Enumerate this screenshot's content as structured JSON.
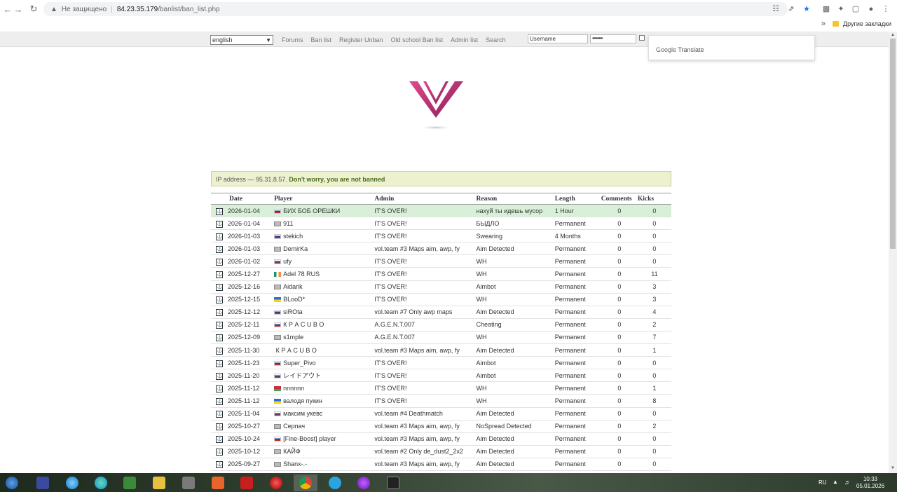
{
  "browser": {
    "security_label": "Не защищено",
    "url_host": "84.23.35.179",
    "url_path": "/banlist/ban_list.php",
    "other_bookmarks": "Другие закладки"
  },
  "site": {
    "language": "english",
    "nav": [
      "Forums",
      "Ban list",
      "Register Unban",
      "Old school Ban list",
      "Admin list",
      "Search"
    ],
    "username_value": "Username",
    "password_mask": "••••••••",
    "google_translate_brand": "Google",
    "google_translate_label": "Translate"
  },
  "notice": {
    "prefix": "IP address — 95.31.8.57.",
    "message": "Don't worry, you are not banned"
  },
  "table": {
    "headers": [
      "Date",
      "Player",
      "Admin",
      "Reason",
      "Length",
      "Comments",
      "Kicks"
    ],
    "rows": [
      {
        "date": "2026-01-04",
        "flag": "ru",
        "player": "БИХ БОБ ОРЕШКИ",
        "admin": "IT'S OVER!",
        "reason": "нахуй ты идешь мусор",
        "length": "1 Hour",
        "comments": "0",
        "kicks": "0"
      },
      {
        "date": "2026-01-04",
        "flag": "un",
        "player": "911",
        "admin": "IT'S OVER!",
        "reason": "БЫДЛО",
        "length": "Permanent",
        "comments": "0",
        "kicks": "0"
      },
      {
        "date": "2026-01-03",
        "flag": "ru",
        "player": "stekich",
        "admin": "IT'S OVER!",
        "reason": "Swearing",
        "length": "4 Months",
        "comments": "0",
        "kicks": "0"
      },
      {
        "date": "2026-01-03",
        "flag": "un",
        "player": "DemirKa",
        "admin": "vol.team #3 Maps aim, awp, fy",
        "reason": "Aim Detected",
        "length": "Permanent",
        "comments": "0",
        "kicks": "0"
      },
      {
        "date": "2026-01-02",
        "flag": "ru",
        "player": "ufy",
        "admin": "IT'S OVER!",
        "reason": "WH",
        "length": "Permanent",
        "comments": "0",
        "kicks": "0"
      },
      {
        "date": "2025-12-27",
        "flag": "ie",
        "player": "Adel 78 RUS",
        "admin": "IT'S OVER!",
        "reason": "WH",
        "length": "Permanent",
        "comments": "0",
        "kicks": "11"
      },
      {
        "date": "2025-12-16",
        "flag": "un",
        "player": "Aidarik",
        "admin": "IT'S OVER!",
        "reason": "Aimbot",
        "length": "Permanent",
        "comments": "0",
        "kicks": "3"
      },
      {
        "date": "2025-12-15",
        "flag": "ua",
        "player": "BLooD*",
        "admin": "IT'S OVER!",
        "reason": "WH",
        "length": "Permanent",
        "comments": "0",
        "kicks": "3"
      },
      {
        "date": "2025-12-12",
        "flag": "ru",
        "player": "siROta",
        "admin": "vol.team #7 Only awp maps",
        "reason": "Aim Detected",
        "length": "Permanent",
        "comments": "0",
        "kicks": "4"
      },
      {
        "date": "2025-12-11",
        "flag": "ru",
        "player": "К Р А С U В О",
        "admin": "A.G.E.N.T.007",
        "reason": "Cheating",
        "length": "Permanent",
        "comments": "0",
        "kicks": "2"
      },
      {
        "date": "2025-12-09",
        "flag": "un",
        "player": "s1mple",
        "admin": "A.G.E.N.T.007",
        "reason": "WH",
        "length": "Permanent",
        "comments": "0",
        "kicks": "7"
      },
      {
        "date": "2025-11-30",
        "flag": "",
        "player": "К Р А С U В О",
        "admin": "vol.team #3 Maps aim, awp, fy",
        "reason": "Aim Detected",
        "length": "Permanent",
        "comments": "0",
        "kicks": "1"
      },
      {
        "date": "2025-11-23",
        "flag": "ru",
        "player": "Super_Pivo",
        "admin": "IT'S OVER!",
        "reason": "Aimbot",
        "length": "Permanent",
        "comments": "0",
        "kicks": "0"
      },
      {
        "date": "2025-11-20",
        "flag": "ru",
        "player": "レイドアウト",
        "admin": "IT'S OVER!",
        "reason": "Aimbot",
        "length": "Permanent",
        "comments": "0",
        "kicks": "0"
      },
      {
        "date": "2025-11-12",
        "flag": "by",
        "player": "nnnnnn",
        "admin": "IT'S OVER!",
        "reason": "WH",
        "length": "Permanent",
        "comments": "0",
        "kicks": "1"
      },
      {
        "date": "2025-11-12",
        "flag": "ua",
        "player": "валодя пукин",
        "admin": "IT'S OVER!",
        "reason": "WH",
        "length": "Permanent",
        "comments": "0",
        "kicks": "8"
      },
      {
        "date": "2025-11-04",
        "flag": "ru",
        "player": "максим укевс",
        "admin": "vol.team #4 Deathmatch",
        "reason": "Aim Detected",
        "length": "Permanent",
        "comments": "0",
        "kicks": "0"
      },
      {
        "date": "2025-10-27",
        "flag": "un",
        "player": "Серпач",
        "admin": "vol.team #3 Maps aim, awp, fy",
        "reason": "NoSpread Detected",
        "length": "Permanent",
        "comments": "0",
        "kicks": "2"
      },
      {
        "date": "2025-10-24",
        "flag": "ru",
        "player": "[Fine-Boost] player",
        "admin": "vol.team #3 Maps aim, awp, fy",
        "reason": "Aim Detected",
        "length": "Permanent",
        "comments": "0",
        "kicks": "0"
      },
      {
        "date": "2025-10-12",
        "flag": "un",
        "player": "КАЙФ",
        "admin": "vol.team #2 Only de_dust2_2x2",
        "reason": "Aim Detected",
        "length": "Permanent",
        "comments": "0",
        "kicks": "0"
      },
      {
        "date": "2025-09-27",
        "flag": "un",
        "player": "Shanx-.-",
        "admin": "vol.team #3 Maps aim, awp, fy",
        "reason": "Aim Detected",
        "length": "Permanent",
        "comments": "0",
        "kicks": "0"
      }
    ]
  },
  "taskbar": {
    "lang": "RU",
    "time": "10:33",
    "date": "05.01.2026",
    "icons": [
      "start-icon",
      "game-icon",
      "ie-icon",
      "edge-icon",
      "chart-app-icon",
      "explorer-icon",
      "tools-icon",
      "orange-app-icon",
      "filezilla-icon",
      "opera-icon",
      "chrome-icon",
      "telegram-icon",
      "purple-app-icon",
      "media-app-icon"
    ]
  }
}
